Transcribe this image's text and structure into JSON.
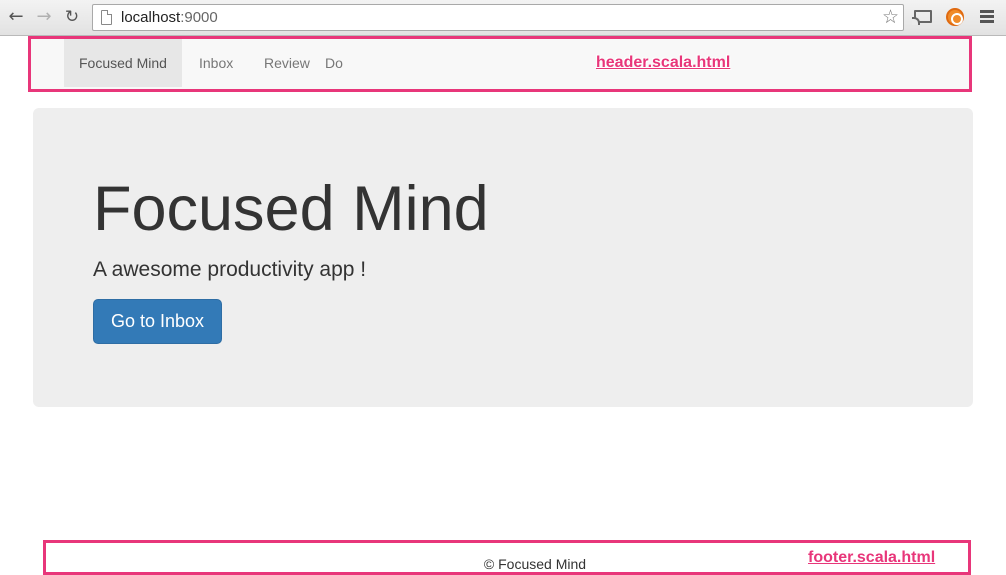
{
  "browser": {
    "url_host": "localhost",
    "url_port": ":9000",
    "back_icon": "arrow-left-icon",
    "forward_icon": "arrow-right-icon",
    "reload_icon": "reload-icon",
    "bookmark_icon": "star-icon",
    "cast_icon": "cast-icon",
    "extension_icon": "extension-icon",
    "menu_icon": "hamburger-menu-icon"
  },
  "navbar": {
    "brand": "Focused Mind",
    "items": [
      {
        "label": "Inbox"
      },
      {
        "label": "Review"
      },
      {
        "label": "Do"
      }
    ]
  },
  "annotations": {
    "header_label": "header.scala.html",
    "footer_label": "footer.scala.html",
    "color": "#e8367a"
  },
  "jumbotron": {
    "title": "Focused Mind",
    "subtitle": "A awesome productivity app !",
    "button_label": "Go to Inbox"
  },
  "footer": {
    "text": "© Focused Mind"
  },
  "colors": {
    "primary_button": "#337ab7",
    "jumbotron_bg": "#eeeeee",
    "navbar_bg": "#f8f8f8"
  }
}
